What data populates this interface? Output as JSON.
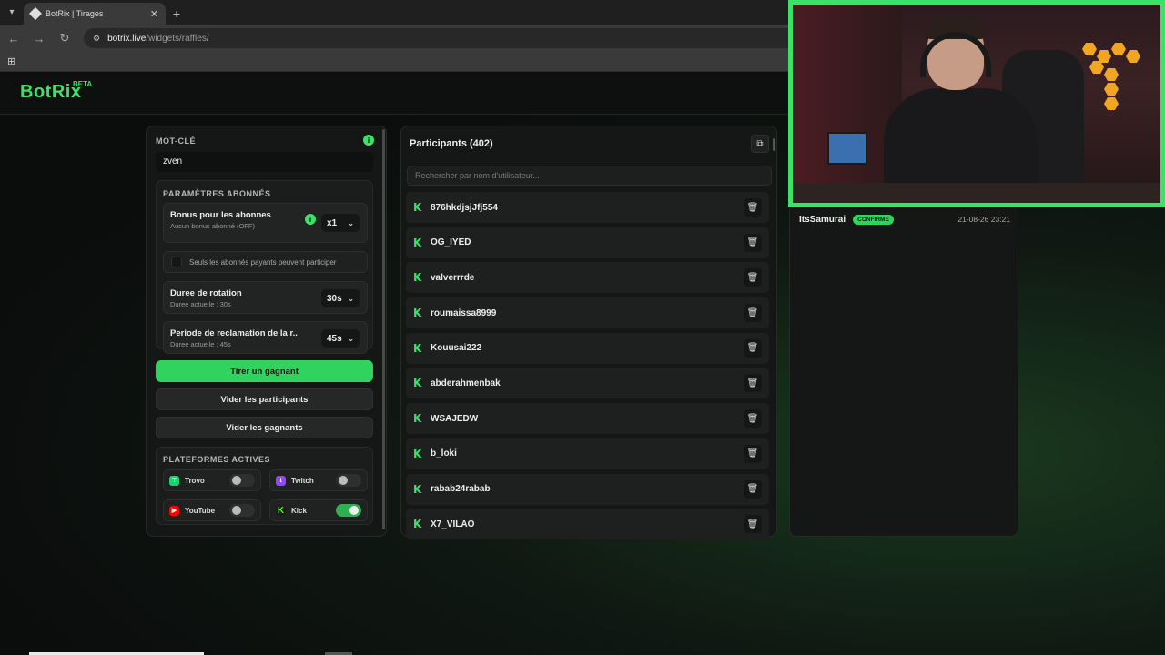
{
  "browser": {
    "tab_title": "BotRix | Tirages",
    "url_host": "botrix.live",
    "url_path": "/widgets/raffles/"
  },
  "app": {
    "logo": "BotRix",
    "logo_badge": "BETA"
  },
  "keyword": {
    "label": "MOT-CLÉ",
    "value": "zven"
  },
  "subscribers": {
    "title": "PARAMÈTRES ABONNÉS",
    "bonus_label": "Bonus pour les abonnes",
    "bonus_sub": "Aucun bonus abonné (OFF)",
    "bonus_value": "x1",
    "paid_only_label": "Seuls les abonnés payants peuvent participer",
    "rotation_label": "Duree de rotation",
    "rotation_sub": "Duree actuelle : 30s",
    "rotation_value": "30s",
    "claim_label": "Periode de reclamation de la r...",
    "claim_sub": "Duree actuelle : 45s",
    "claim_value": "45s"
  },
  "actions": {
    "draw": "Tirer un gagnant",
    "clear_participants": "Vider les participants",
    "clear_winners": "Vider les gagnants"
  },
  "platforms": {
    "title": "PLATEFORMES ACTIVES",
    "items": [
      {
        "name": "Trovo",
        "enabled": false,
        "color": "#19d66b"
      },
      {
        "name": "Twitch",
        "enabled": false,
        "color": "#9146ff"
      },
      {
        "name": "YouTube",
        "enabled": false,
        "color": "#ff0000"
      },
      {
        "name": "Kick",
        "enabled": true,
        "color": "#53fc18"
      }
    ]
  },
  "participants": {
    "title": "Participants (402)",
    "search_placeholder": "Rechercher par nom d'utilisateur...",
    "items": [
      "876hkdjsjJfj554",
      "OG_IYED",
      "valverrrde",
      "roumaissa8999",
      "Kouusai222",
      "abderahmenbak",
      "WSAJEDW",
      "b_loki",
      "rabab24rabab",
      "X7_VILAO"
    ]
  },
  "winners": {
    "items": [
      {
        "name": "ItsSamurai",
        "status": "CONFIRME",
        "date": "21-08-26 23:21"
      }
    ]
  },
  "colors": {
    "accent": "#3ee06a",
    "button_green": "#2fd35e"
  }
}
